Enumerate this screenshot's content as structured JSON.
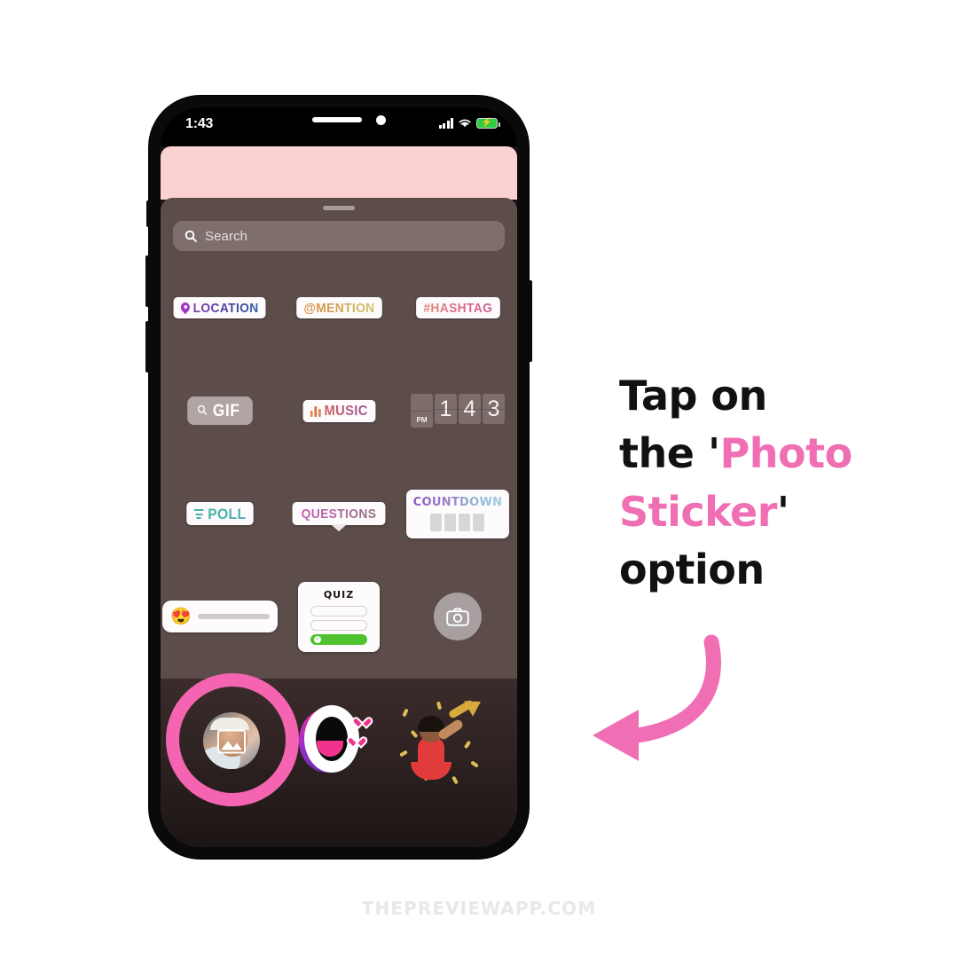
{
  "status_bar": {
    "time": "1:43",
    "signal_icon": "cellular-signal-icon",
    "wifi_icon": "wifi-icon",
    "battery_icon": "battery-charging-icon"
  },
  "search": {
    "placeholder": "Search",
    "value": "",
    "icon": "search-icon"
  },
  "stickers": {
    "row1": [
      {
        "id": "location",
        "label": "LOCATION",
        "icon": "location-pin-icon"
      },
      {
        "id": "mention",
        "label": "@MENTION",
        "icon": null
      },
      {
        "id": "hashtag",
        "label": "#HASHTAG",
        "icon": null
      }
    ],
    "row2": [
      {
        "id": "gif",
        "label": "GIF",
        "icon": "search-icon"
      },
      {
        "id": "music",
        "label": "MUSIC",
        "icon": "music-bars-icon"
      },
      {
        "id": "time",
        "label": "1 4 3",
        "meridiem": "PM",
        "digits": [
          "1",
          "4",
          "3"
        ]
      }
    ],
    "row3": [
      {
        "id": "poll",
        "label": "POLL",
        "icon": "poll-bars-icon"
      },
      {
        "id": "questions",
        "label": "QUESTIONS",
        "icon": null
      },
      {
        "id": "countdown",
        "label": "COUNTDOWN",
        "blocks": 4
      }
    ],
    "row4": [
      {
        "id": "emoji-slider",
        "label": "",
        "emoji": "😍"
      },
      {
        "id": "quiz",
        "label": "QUIZ",
        "options": 3,
        "correct_index": 2
      },
      {
        "id": "camera",
        "label": "",
        "icon": "camera-icon"
      }
    ]
  },
  "bottom_stickers": [
    {
      "id": "photo-sticker",
      "name": "photo-sticker",
      "highlighted": true
    },
    {
      "id": "mouth-sticker",
      "name": "open-mouth-sticker",
      "highlighted": false
    },
    {
      "id": "trumpet-sticker",
      "name": "trumpet-dancer-sticker",
      "highlighted": false
    }
  ],
  "callout": {
    "line1": "Tap on",
    "line2_prefix": "the '",
    "line2_accent": "Photo",
    "line3_accent": "Sticker",
    "line3_suffix": "'",
    "line4": "option",
    "accent_color": "#f06eb4",
    "arrow_icon": "curved-left-arrow-icon"
  },
  "watermark": {
    "text": "THEPREVIEWAPP.COM"
  },
  "colors": {
    "tray_background": "#5c4c4a",
    "header_pink": "#fbd2d2",
    "search_background": "#7e6f6d",
    "highlight_pink": "#f464b0",
    "accent_pink": "#f06eb4"
  }
}
